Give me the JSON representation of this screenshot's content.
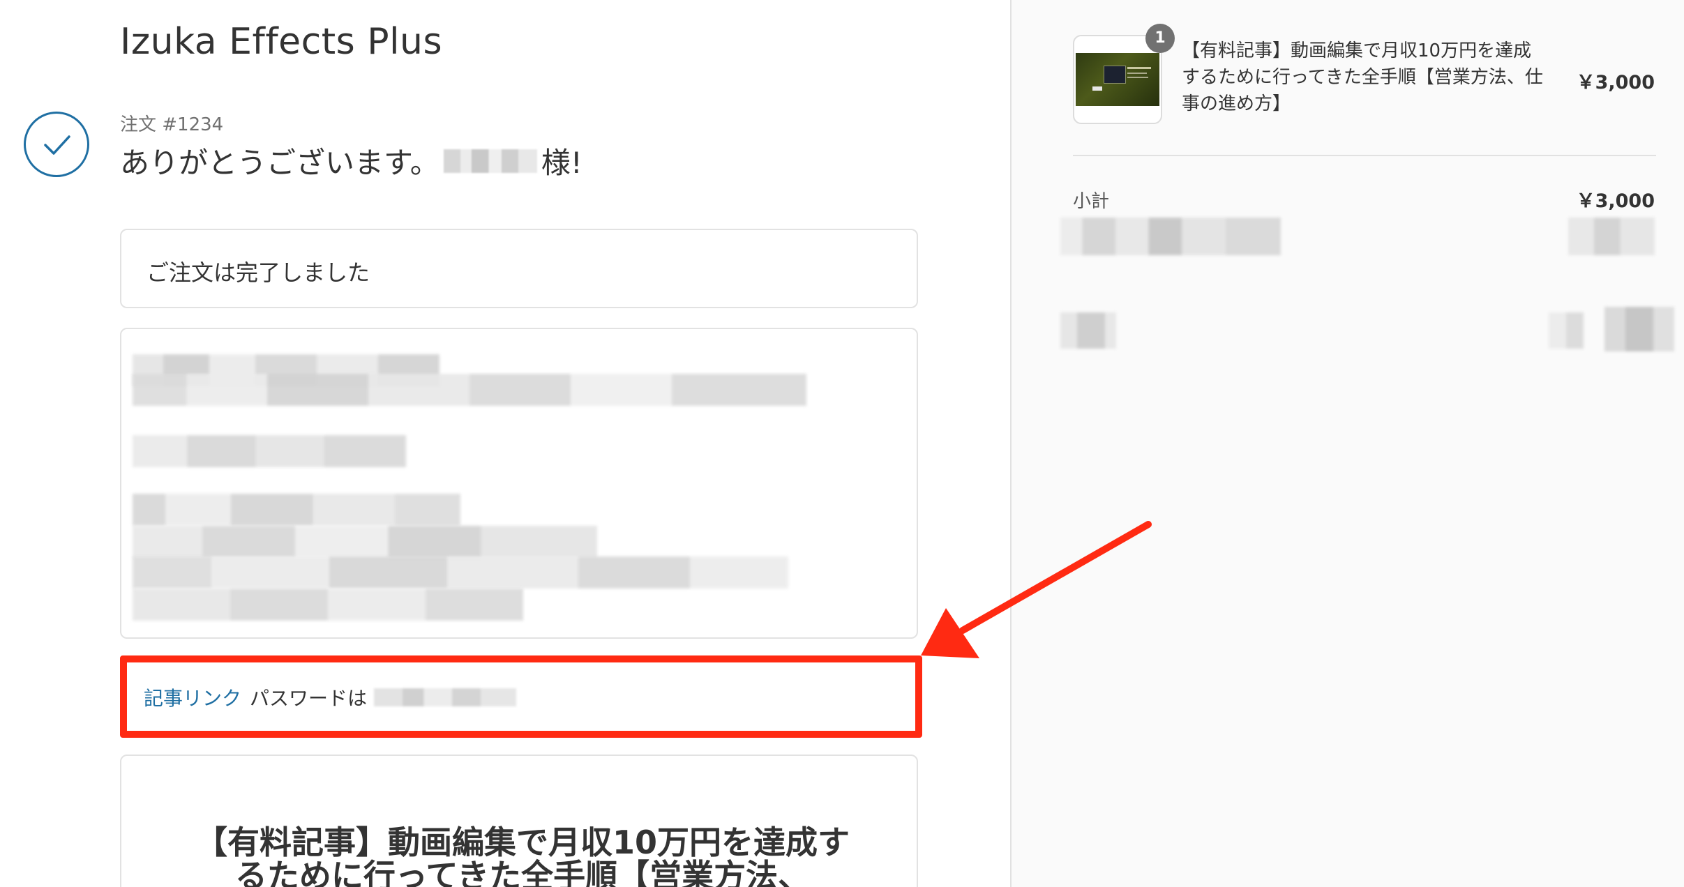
{
  "shop": {
    "name": "Izuka Effects Plus"
  },
  "order": {
    "number_label": "注文 #1234",
    "thanks_prefix": "ありがとうございます。",
    "thanks_suffix": "様!"
  },
  "status_box": {
    "text": "ご注文は完了しました"
  },
  "link_row": {
    "link_label": "記事リンク",
    "password_label": "パスワードは"
  },
  "article_box": {
    "title": "【有料記事】動画編集で月収10万円を達成するために行ってきた全手順【営業方法、"
  },
  "sidebar": {
    "item": {
      "quantity": "1",
      "title": "【有料記事】動画編集で月収10万円を達成するために行ってきた全手順【営業方法、仕事の進め方】",
      "price": "￥3,000",
      "thumbnail_icon": "product-thumbnail"
    },
    "subtotal_label": "小計",
    "subtotal_value": "￥3,000"
  },
  "colors": {
    "accent_blue": "#1f6fa3",
    "highlight_red": "#ff2a12",
    "sidebar_bg": "#fafafa"
  }
}
